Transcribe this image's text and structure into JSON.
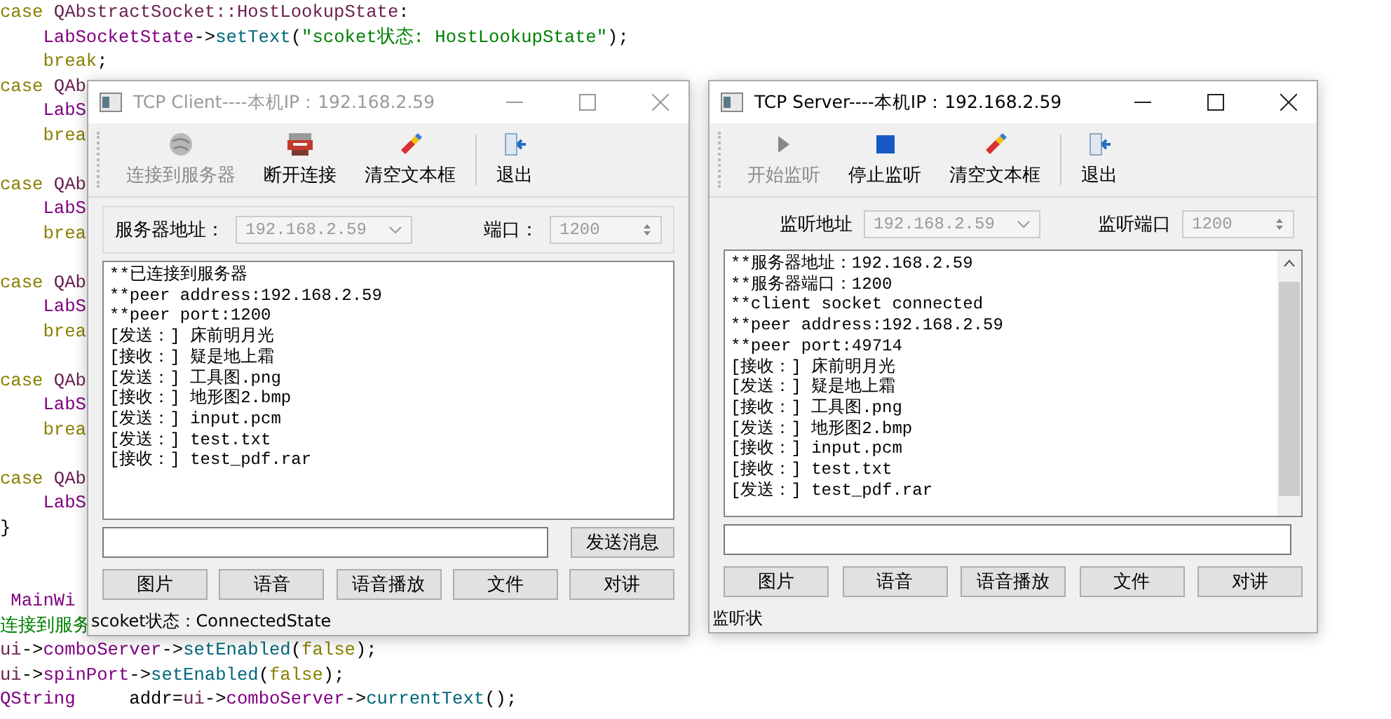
{
  "editor": {
    "blocks": [
      {
        "lines": [
          {
            "parts": [
              {
                "kind": "keyword",
                "text": "case"
              },
              {
                "kind": "type",
                "text": " QAbstractSocket::HostLookupState"
              },
              {
                "kind": "plain",
                "text": ":"
              }
            ]
          },
          {
            "parts": [
              {
                "kind": "member",
                "text": "    LabSocketState"
              },
              {
                "kind": "plain",
                "text": "->"
              },
              {
                "kind": "func",
                "text": "setText"
              },
              {
                "kind": "plain",
                "text": "("
              },
              {
                "kind": "string",
                "text": "\"scoket状态: HostLookupState\""
              },
              {
                "kind": "plain",
                "text": ");"
              }
            ]
          },
          {
            "parts": [
              {
                "kind": "keyword",
                "text": "    break"
              },
              {
                "kind": "plain",
                "text": ";"
              }
            ]
          },
          {
            "parts": [
              {
                "kind": "keyword",
                "text": "case"
              },
              {
                "kind": "type",
                "text": " QAb"
              }
            ]
          },
          {
            "parts": [
              {
                "kind": "member",
                "text": "    LabS"
              }
            ]
          },
          {
            "parts": [
              {
                "kind": "keyword",
                "text": "    brea"
              }
            ]
          }
        ]
      },
      {
        "lines": [
          {
            "parts": [
              {
                "kind": "keyword",
                "text": "case"
              },
              {
                "kind": "type",
                "text": " QAb"
              }
            ]
          },
          {
            "parts": [
              {
                "kind": "member",
                "text": "    LabS"
              }
            ]
          },
          {
            "parts": [
              {
                "kind": "keyword",
                "text": "    brea"
              }
            ]
          }
        ]
      },
      {
        "lines": [
          {
            "parts": [
              {
                "kind": "keyword",
                "text": "case"
              },
              {
                "kind": "type",
                "text": " QAb"
              }
            ]
          },
          {
            "parts": [
              {
                "kind": "member",
                "text": "    LabS"
              }
            ]
          },
          {
            "parts": [
              {
                "kind": "keyword",
                "text": "    brea"
              }
            ]
          }
        ]
      },
      {
        "lines": [
          {
            "parts": [
              {
                "kind": "keyword",
                "text": "case"
              },
              {
                "kind": "type",
                "text": " QAb"
              }
            ]
          },
          {
            "parts": [
              {
                "kind": "member",
                "text": "    LabS"
              }
            ]
          },
          {
            "parts": [
              {
                "kind": "keyword",
                "text": "    brea"
              }
            ]
          }
        ]
      },
      {
        "lines": [
          {
            "parts": [
              {
                "kind": "keyword",
                "text": "case"
              },
              {
                "kind": "type",
                "text": " QAb"
              }
            ]
          },
          {
            "parts": [
              {
                "kind": "member",
                "text": "    LabS"
              }
            ]
          },
          {
            "parts": [
              {
                "kind": "plain",
                "text": "}"
              }
            ]
          }
        ]
      }
    ],
    "lower_lines": [
      {
        "parts": [
          {
            "kind": "member",
            "text": " MainWi"
          }
        ]
      },
      {
        "parts": [
          {
            "kind": "string",
            "text": "连接到服务"
          }
        ]
      },
      {
        "parts": [
          {
            "kind": "type",
            "text": "ui"
          },
          {
            "kind": "plain",
            "text": "->"
          },
          {
            "kind": "member",
            "text": "comboServer"
          },
          {
            "kind": "plain",
            "text": "->"
          },
          {
            "kind": "func",
            "text": "setEnabled"
          },
          {
            "kind": "plain",
            "text": "("
          },
          {
            "kind": "keyword",
            "text": "false"
          },
          {
            "kind": "plain",
            "text": ");"
          }
        ]
      },
      {
        "parts": [
          {
            "kind": "type",
            "text": "ui"
          },
          {
            "kind": "plain",
            "text": "->"
          },
          {
            "kind": "member",
            "text": "spinPort"
          },
          {
            "kind": "plain",
            "text": "->"
          },
          {
            "kind": "func",
            "text": "setEnabled"
          },
          {
            "kind": "plain",
            "text": "("
          },
          {
            "kind": "keyword",
            "text": "false"
          },
          {
            "kind": "plain",
            "text": ");"
          }
        ]
      },
      {
        "parts": [
          {
            "kind": "member",
            "text": "QString"
          },
          {
            "kind": "plain",
            "text": "     addr="
          },
          {
            "kind": "type",
            "text": "ui"
          },
          {
            "kind": "plain",
            "text": "->"
          },
          {
            "kind": "member",
            "text": "comboServer"
          },
          {
            "kind": "plain",
            "text": "->"
          },
          {
            "kind": "func",
            "text": "currentText"
          },
          {
            "kind": "plain",
            "text": "();"
          }
        ]
      }
    ]
  },
  "windows": [
    {
      "title": "TCP Client----本机IP：192.168.2.59",
      "active": false,
      "toolbar": [
        {
          "kind": "connect",
          "label": "连接到服务器",
          "disabled": true
        },
        {
          "kind": "disconnect",
          "label": "断开连接",
          "disabled": false
        },
        {
          "kind": "clear",
          "label": "清空文本框",
          "disabled": false
        },
        {
          "kind": "exit",
          "label": "退出",
          "disabled": false
        }
      ],
      "address": {
        "label": "服务器地址：",
        "value": "192.168.2.59",
        "disabled": true
      },
      "port": {
        "label": "端口：",
        "value": "1200",
        "disabled": true
      },
      "log": [
        "**已连接到服务器",
        "**peer address:192.168.2.59",
        "**peer port:1200",
        "[发送：] 床前明月光",
        "[接收：] 疑是地上霜",
        "[发送：] 工具图.png",
        "[接收：] 地形图2.bmp",
        "[发送：] input.pcm",
        "[发送：] test.txt",
        "[接收：] test_pdf.rar"
      ],
      "send_button": "发送消息",
      "buttons": [
        "图片",
        "语音",
        "语音播放",
        "文件",
        "对讲"
      ],
      "status": "scoket状态：ConnectedState"
    },
    {
      "title": "TCP Server----本机IP：192.168.2.59",
      "active": true,
      "toolbar": [
        {
          "kind": "start",
          "label": "开始监听",
          "disabled": true
        },
        {
          "kind": "stop",
          "label": "停止监听",
          "disabled": false
        },
        {
          "kind": "clear",
          "label": "清空文本框",
          "disabled": false
        },
        {
          "kind": "exit",
          "label": "退出",
          "disabled": false
        }
      ],
      "address": {
        "label": "监听地址",
        "value": "192.168.2.59",
        "disabled": true
      },
      "port": {
        "label": "监听端口",
        "value": "1200",
        "disabled": true
      },
      "log": [
        "**服务器地址：192.168.2.59",
        "**服务器端口：1200",
        "**client socket connected",
        "**peer address:192.168.2.59",
        "**peer port:49714",
        "[接收：] 床前明月光",
        "[发送：] 疑是地上霜",
        "[接收：] 工具图.png",
        "[发送：] 地形图2.bmp",
        "[接收：] input.pcm",
        "[接收：] test.txt",
        "[发送：] test_pdf.rar"
      ],
      "scrollbar": true,
      "buttons": [
        "图片",
        "语音",
        "语音播放",
        "文件",
        "对讲"
      ],
      "status": "监听状"
    }
  ]
}
